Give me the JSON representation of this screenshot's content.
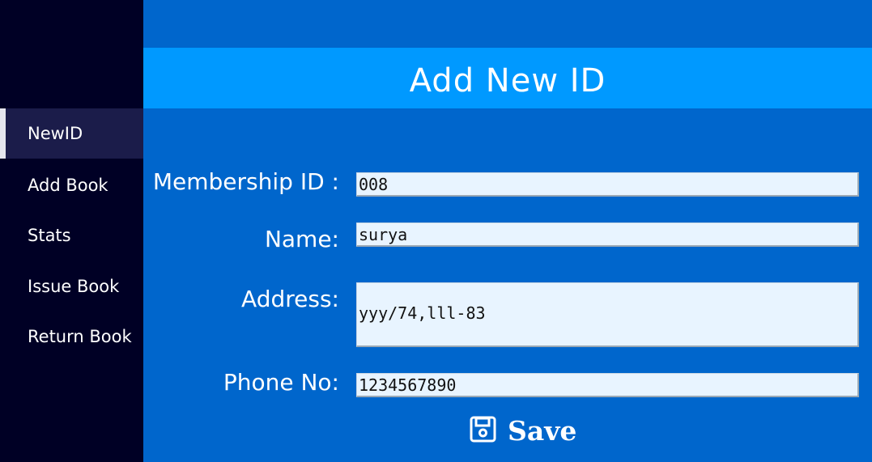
{
  "sidebar": {
    "items": [
      {
        "label": "NewID",
        "active": true
      },
      {
        "label": "Add Book",
        "active": false
      },
      {
        "label": "Stats",
        "active": false
      },
      {
        "label": "Issue Book",
        "active": false
      },
      {
        "label": "Return Book",
        "active": false
      }
    ]
  },
  "banner": {
    "title": "Add New ID"
  },
  "form": {
    "membership_id": {
      "label": "Membership ID :",
      "value": "008"
    },
    "name": {
      "label": "Name:",
      "value": "surya"
    },
    "address": {
      "label": "Address:",
      "value": "yyy/74,lll-83"
    },
    "phone": {
      "label": "Phone No:",
      "value": "1234567890"
    }
  },
  "save_button": {
    "label": "Save",
    "icon": "floppy-disk-icon"
  },
  "colors": {
    "sidebar_bg": "#000025",
    "sidebar_active_bg": "#1b1c4a",
    "main_bg": "#0066cc",
    "banner_bg": "#0099ff",
    "field_bg": "#e8f4ff"
  }
}
